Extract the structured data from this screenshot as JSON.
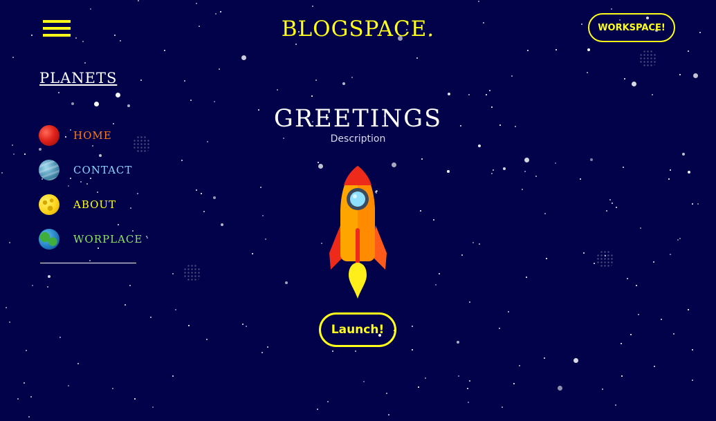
{
  "header": {
    "menu_icon": "hamburger-menu-icon",
    "brand": "BLOGSPACE.",
    "workspace_button": "WORKSPACE!"
  },
  "sidebar": {
    "title": "PLANETS",
    "items": [
      {
        "label": "HOME",
        "icon": "red-planet-icon",
        "color": "#ff7a1a"
      },
      {
        "label": "CONTACT",
        "icon": "blue-planet-icon",
        "color": "#8fd3ff"
      },
      {
        "label": "ABOUT",
        "icon": "yellow-planet-icon",
        "color": "#ffff1a"
      },
      {
        "label": "WORPLACE",
        "icon": "earth-planet-icon",
        "color": "#8fe36a"
      }
    ]
  },
  "main": {
    "title": "GREETINGS",
    "description": "Description",
    "rocket_icon": "rocket-icon",
    "launch_button": "Launch!"
  },
  "colors": {
    "background": "#01024a",
    "accent": "#ffff1a"
  }
}
